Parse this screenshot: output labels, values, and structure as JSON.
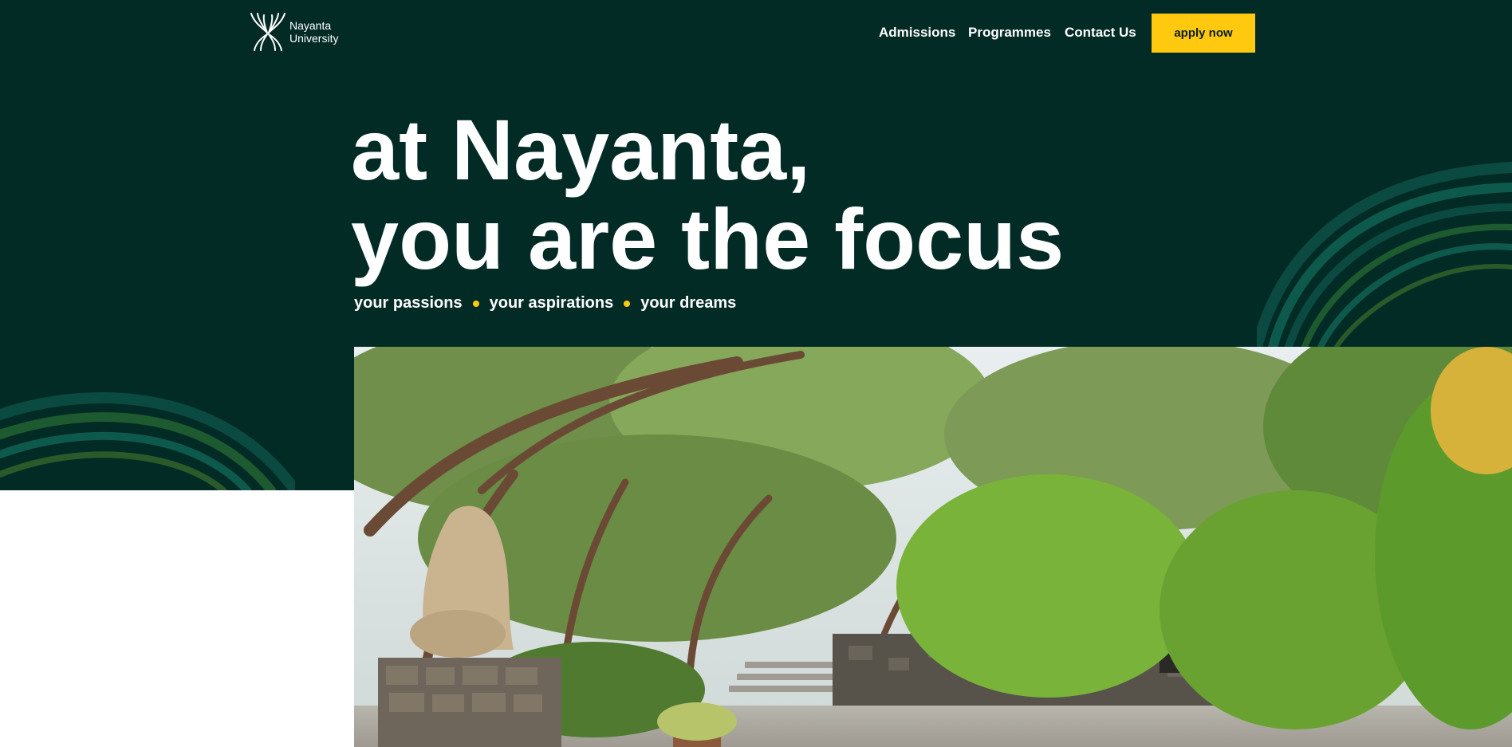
{
  "brand": {
    "name_line1": "Nayanta",
    "name_line2": "University",
    "logo_icon": "butterfly-lines-logo"
  },
  "nav": {
    "items": [
      {
        "label": "Admissions"
      },
      {
        "label": "Programmes"
      },
      {
        "label": "Contact Us"
      }
    ],
    "cta_label": "apply now"
  },
  "hero": {
    "headline_line1": "at Nayanta,",
    "headline_line2": "you are the focus",
    "tags": [
      "your passions",
      "your aspirations",
      "your dreams"
    ]
  },
  "colors": {
    "background": "#032b26",
    "accent": "#ffc90f",
    "text": "#ffffff"
  },
  "image": {
    "subject": "campus-garden-photo"
  }
}
